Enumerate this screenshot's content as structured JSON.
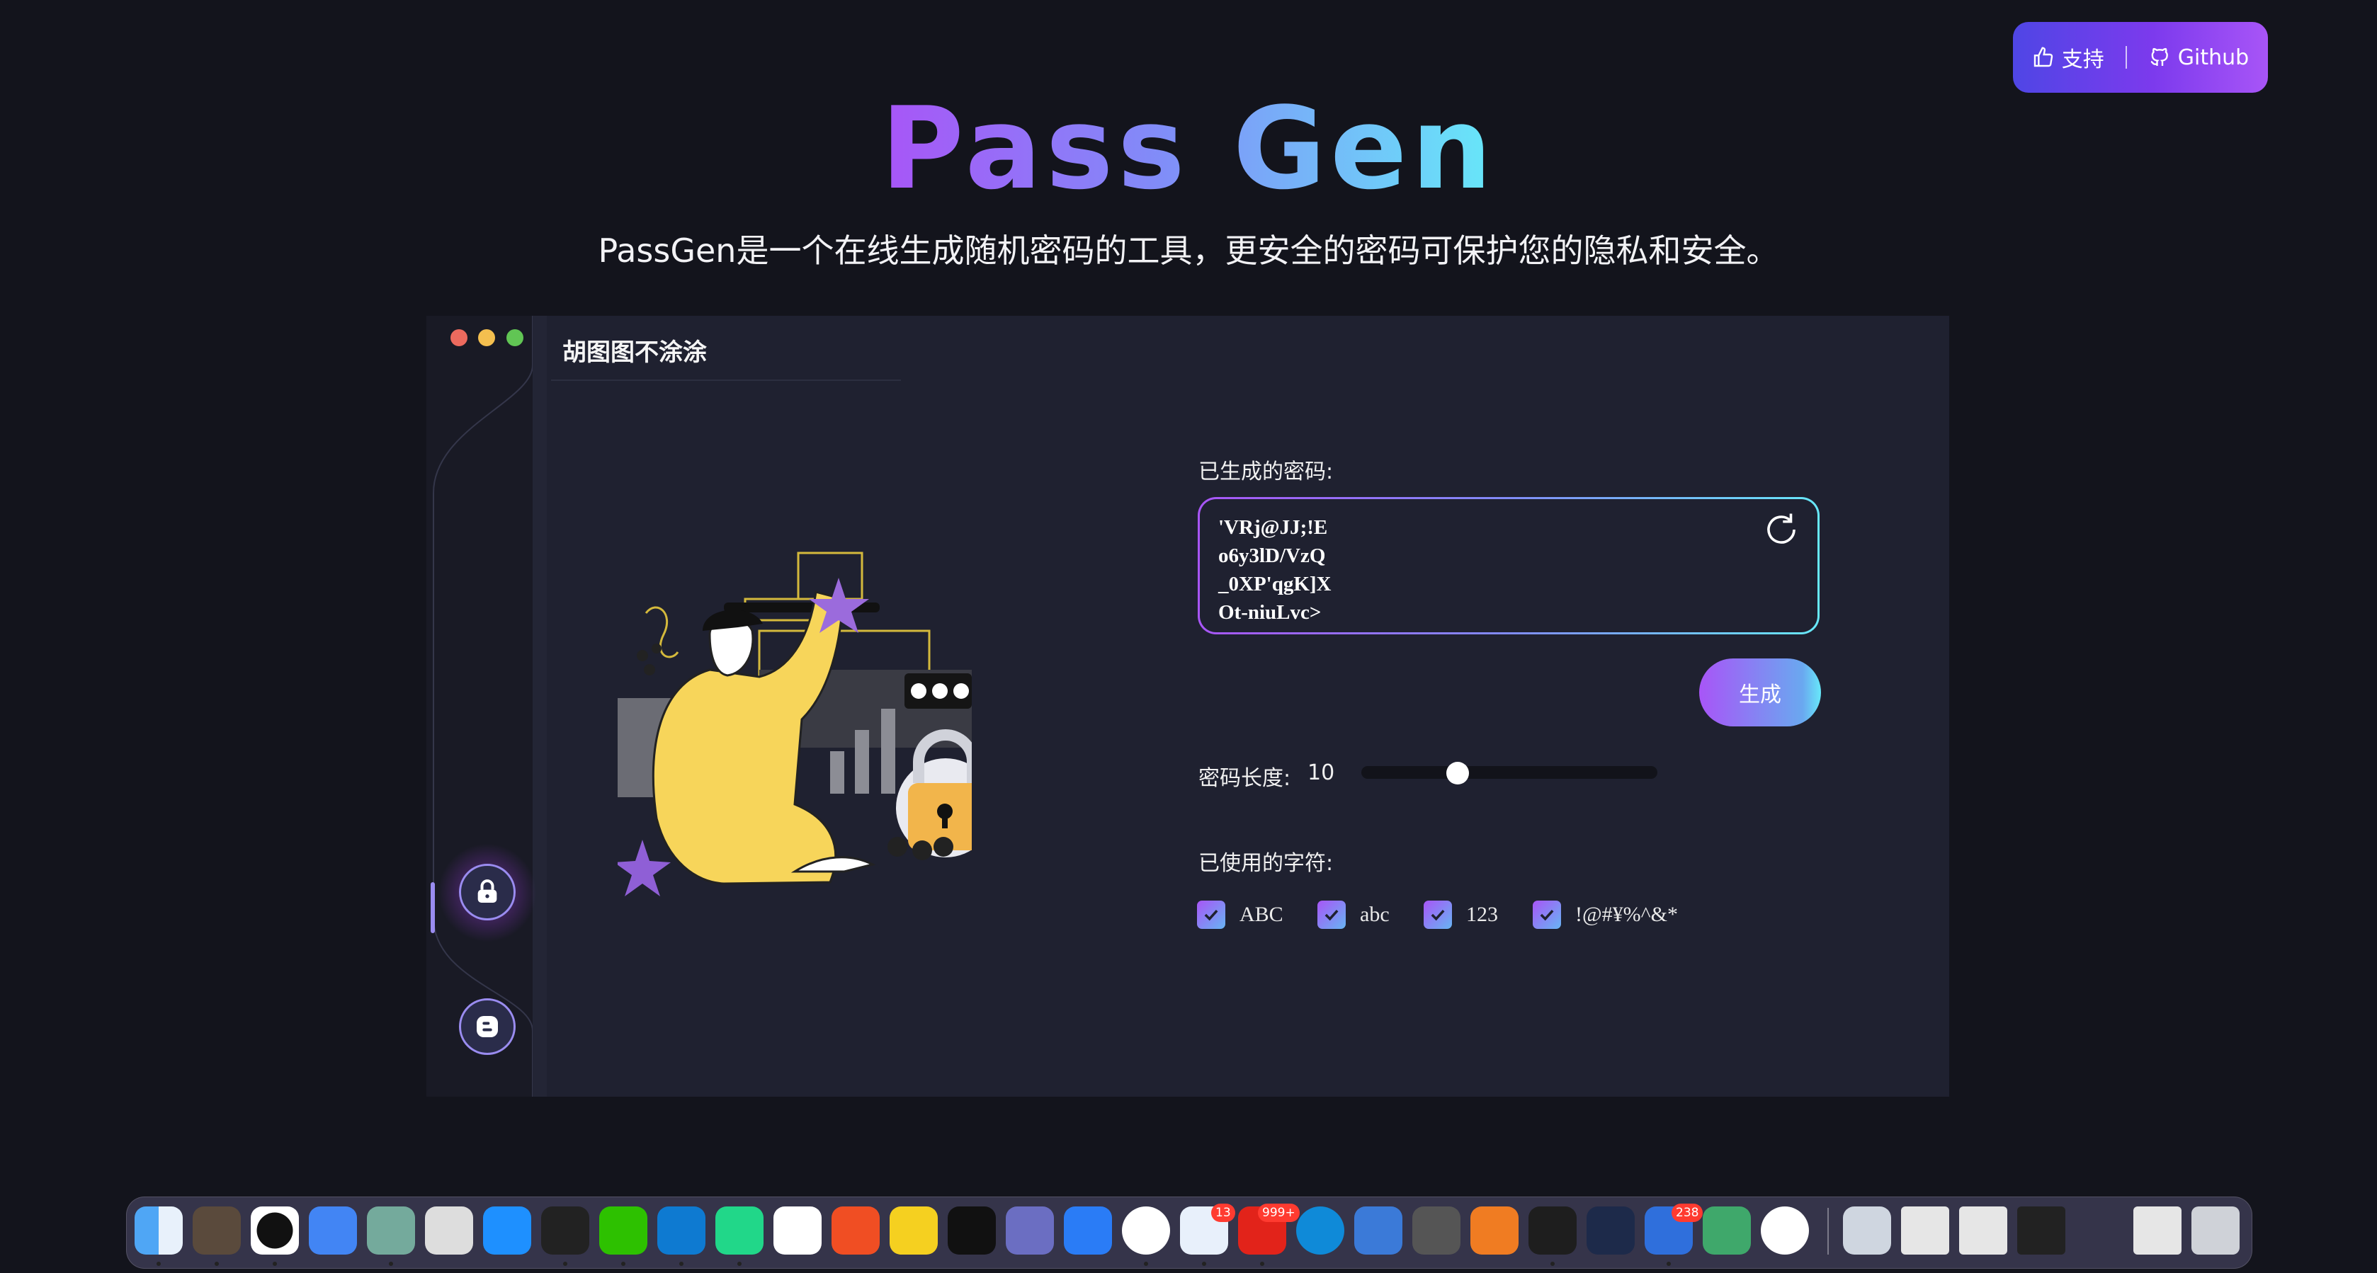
{
  "header": {
    "support_label": "支持",
    "github_label": "Github",
    "title": "Pass Gen",
    "subtitle": "PassGen是一个在线生成随机密码的工具，更安全的密码可保护您的隐私和安全。"
  },
  "panel": {
    "app_name": "胡图图不涂涂",
    "window_dots": [
      "#ec6a5e",
      "#f4bf4f",
      "#61c554"
    ]
  },
  "password": {
    "label": "已生成的密码:",
    "lines": [
      "'VRj@JJ;!E",
      "o6y3lD/VzQ",
      "_0XP'qgK]X",
      "Ot-niuLvc>"
    ]
  },
  "generate_label": "生成",
  "length": {
    "label": "密码长度:",
    "value": "10"
  },
  "chars": {
    "label": "已使用的字符:",
    "options": [
      {
        "label": "ABC",
        "checked": true
      },
      {
        "label": "abc",
        "checked": true
      },
      {
        "label": "123",
        "checked": true
      },
      {
        "label": "!@#¥%^&*",
        "checked": true
      }
    ]
  },
  "dock": {
    "badges": [
      "13",
      "999+",
      "238"
    ]
  }
}
